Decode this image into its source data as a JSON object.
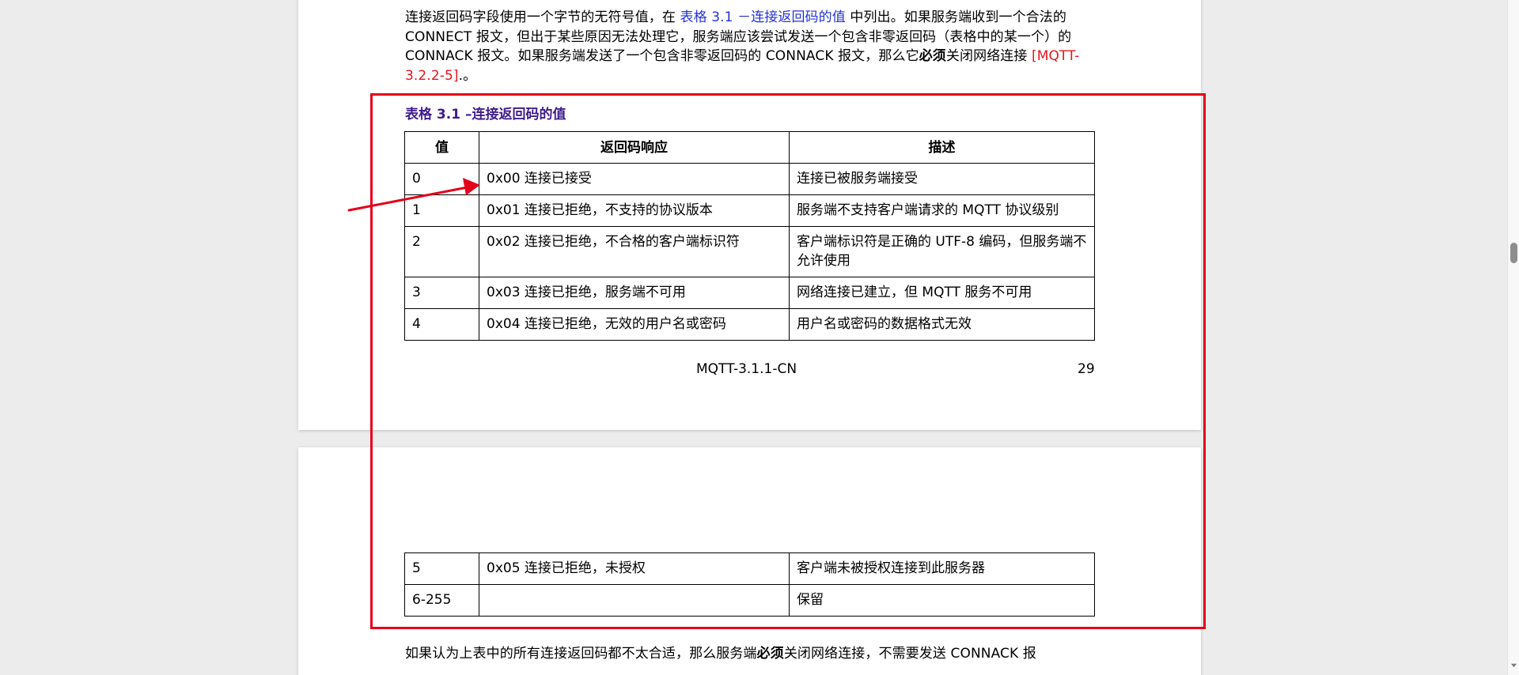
{
  "document": {
    "intro": {
      "part1": "连接返回码字段使用一个字节的无符号值，在 ",
      "link_table": "表格 3.1 －连接返回码的值",
      "part2": " 中列出。如果服务端收到一个合法的 CONNECT 报文，但出于某些原因无法处理它，服务端应该尝试发送一个包含非零返回码（表格中的某一个）的 CONNACK 报文。如果服务端发送了一个包含非零返回码的 CONNACK 报文，那么它",
      "must": "必须",
      "part3": "关闭网络连接 ",
      "ref": "[MQTT-3.2.2-5]",
      "part4": ".。"
    },
    "table_caption": "表格 3.1 –连接返回码的值",
    "table": {
      "headers": [
        "值",
        "返回码响应",
        "描述"
      ],
      "rows_page1": [
        {
          "value": "0",
          "response": "0x00 连接已接受",
          "description": "连接已被服务端接受"
        },
        {
          "value": "1",
          "response": "0x01 连接已拒绝，不支持的协议版本",
          "description": "服务端不支持客户端请求的 MQTT 协议级别"
        },
        {
          "value": "2",
          "response": "0x02 连接已拒绝，不合格的客户端标识符",
          "description": "客户端标识符是正确的 UTF-8 编码，但服务端不允许使用"
        },
        {
          "value": "3",
          "response": "0x03 连接已拒绝，服务端不可用",
          "description": "网络连接已建立，但 MQTT 服务不可用"
        },
        {
          "value": "4",
          "response": "0x04 连接已拒绝，无效的用户名或密码",
          "description": "用户名或密码的数据格式无效"
        }
      ],
      "rows_page2": [
        {
          "value": "5",
          "response": "0x05 连接已拒绝，未授权",
          "description": "客户端未被授权连接到此服务器"
        },
        {
          "value": "6-255",
          "response": "",
          "description": "保留"
        }
      ]
    },
    "footer": {
      "title": "MQTT-3.1.1-CN",
      "page_number": "29"
    },
    "outro": {
      "part1": "如果认为上表中的所有连接返回码都不太合适，那么服务端",
      "must": "必须",
      "part2": "关闭网络连接，不需要发送 CONNACK 报"
    }
  },
  "colors": {
    "link_blue": "#2432d8",
    "ref_red": "#e8141c",
    "caption_purple": "#3f1c8c",
    "annotation_red": "#e3001b"
  }
}
